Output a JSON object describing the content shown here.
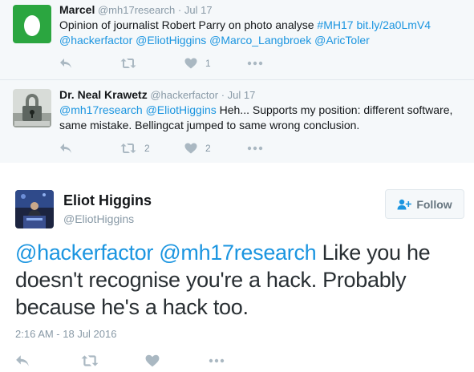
{
  "replies": [
    {
      "name": "Marcel",
      "handle": "@mh17research",
      "separator": "·",
      "date": "Jul 17",
      "text_plain": "Opinion of journalist Robert Parry on photo analyse ",
      "hashtag": "#MH17",
      "url": "bit.ly/2a0LmV4",
      "mentions": "@hackerfactor @EliotHiggins @Marco_Langbroek @AricToler",
      "retweet_count": "",
      "like_count": "1",
      "avatar_icon": "egg-icon",
      "avatar_color": "#2ba640"
    },
    {
      "name": "Dr. Neal Krawetz",
      "handle": "@hackerfactor",
      "separator": "·",
      "date": "Jul 17",
      "mentions": "@mh17research @EliotHiggins",
      "text_plain": " Heh... Supports my position: different software, same mistake. Bellingcat jumped to same wrong conclusion.",
      "retweet_count": "2",
      "like_count": "2",
      "avatar_icon": "padlock-icon"
    }
  ],
  "main_tweet": {
    "name": "Eliot Higgins",
    "handle": "@EliotHiggins",
    "follow_label": "Follow",
    "mentions": "@hackerfactor @mh17research",
    "text_plain": " Like you he doesn't recognise you're a hack. Probably because he's a hack too.",
    "timestamp": "2:16 AM - 18 Jul 2016",
    "avatar_icon": "speaker-photo-icon"
  },
  "icons": {
    "reply": "reply-icon",
    "retweet": "retweet-icon",
    "like": "heart-icon",
    "more": "more-dots-icon"
  },
  "colors": {
    "link": "#1b95e0",
    "thread_bg": "#f5f8fa",
    "muted": "#8899a6",
    "icon": "#aab8c2"
  }
}
